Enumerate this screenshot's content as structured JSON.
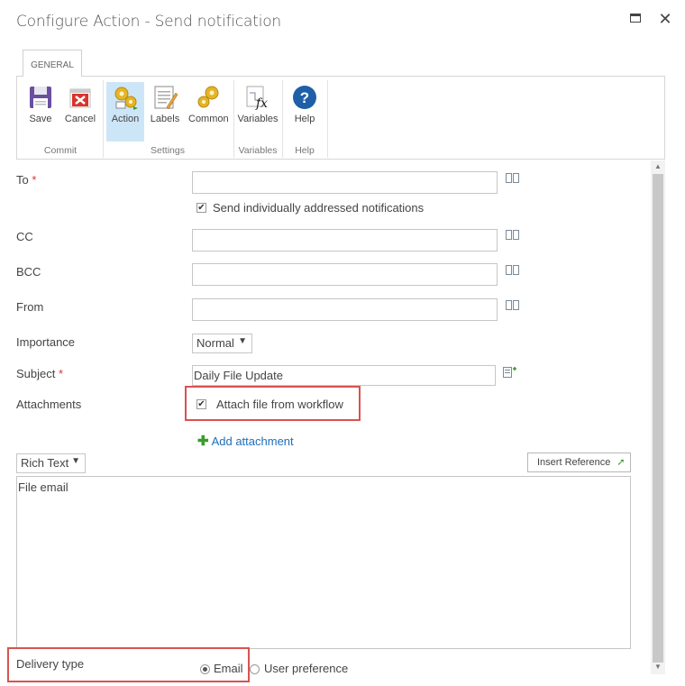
{
  "window": {
    "title": "Configure Action - Send notification"
  },
  "ribbon": {
    "tab": "GENERAL",
    "buttons": [
      {
        "label": "Save",
        "icon": "save-icon"
      },
      {
        "label": "Cancel",
        "icon": "cancel-icon"
      },
      {
        "label": "Action",
        "icon": "action-gears-icon"
      },
      {
        "label": "Labels",
        "icon": "labels-icon"
      },
      {
        "label": "Common",
        "icon": "common-gears-icon"
      },
      {
        "label": "Variables",
        "icon": "variables-fx-icon"
      },
      {
        "label": "Help",
        "icon": "help-icon"
      }
    ],
    "groups": [
      "Commit",
      "Settings",
      "Variables",
      "Help"
    ]
  },
  "form": {
    "to": {
      "label": "To",
      "required": "*",
      "value": ""
    },
    "send_individually": {
      "label": "Send individually addressed notifications",
      "checked": true
    },
    "cc": {
      "label": "CC",
      "value": ""
    },
    "bcc": {
      "label": "BCC",
      "value": ""
    },
    "from": {
      "label": "From",
      "value": ""
    },
    "importance": {
      "label": "Importance",
      "value": "Normal"
    },
    "subject": {
      "label": "Subject",
      "required": "*",
      "value": "Daily File Update"
    },
    "attachments": {
      "label": "Attachments",
      "attach_label": "Attach file from workflow",
      "checked": true,
      "add_label": "Add attachment"
    },
    "body": {
      "format": "Rich Text",
      "insert_reference": "Insert Reference",
      "content": "File email"
    },
    "delivery": {
      "label": "Delivery type",
      "options": [
        "Email",
        "User preference"
      ],
      "selected": "Email"
    }
  },
  "colors": {
    "highlight": "#d9534f",
    "link": "#1e6fb8",
    "active_button": "#cde6f7"
  }
}
